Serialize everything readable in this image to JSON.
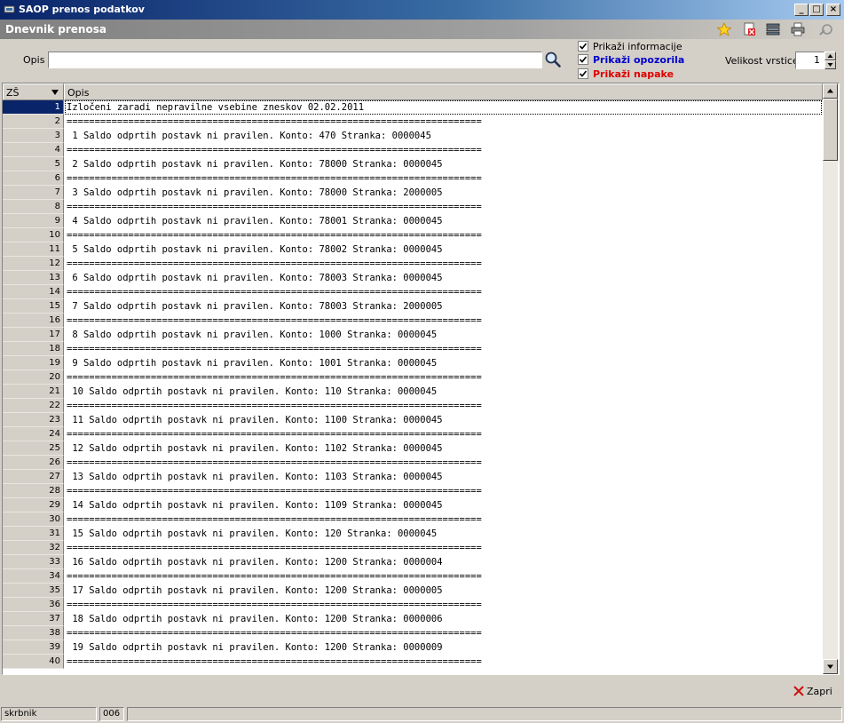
{
  "window": {
    "title": "SAOP prenos podatkov"
  },
  "panel": {
    "title": "Dnevnik prenosa"
  },
  "toolbar": {
    "icons": [
      "favorite-star-icon",
      "delete-doc-icon",
      "stack-icon",
      "print-icon",
      "tools-icon"
    ]
  },
  "filter": {
    "opis_label": "Opis",
    "opis_value": "",
    "show_info": {
      "label": "Prikaži informacije",
      "checked": true,
      "color": "#000000"
    },
    "show_warnings": {
      "label": "Prikaži opozorila",
      "checked": true,
      "color": "#0000cc"
    },
    "show_errors": {
      "label": "Prikaži napake",
      "checked": true,
      "color": "#dd0000"
    },
    "row_size_label": "Velikost vrstice",
    "row_size_value": "1"
  },
  "grid": {
    "columns": [
      "ZŠ",
      "Opis"
    ],
    "rows": [
      {
        "n": "1",
        "text": "Izločeni zaradi nepravilne vsebine zneskov 02.02.2011"
      },
      {
        "n": "2",
        "text": "=========================================================================="
      },
      {
        "n": "3",
        "text": " 1 Saldo odprtih postavk ni pravilen. Konto: 470 Stranka: 0000045"
      },
      {
        "n": "4",
        "text": "=========================================================================="
      },
      {
        "n": "5",
        "text": " 2 Saldo odprtih postavk ni pravilen. Konto: 78000 Stranka: 0000045"
      },
      {
        "n": "6",
        "text": "=========================================================================="
      },
      {
        "n": "7",
        "text": " 3 Saldo odprtih postavk ni pravilen. Konto: 78000 Stranka: 2000005"
      },
      {
        "n": "8",
        "text": "=========================================================================="
      },
      {
        "n": "9",
        "text": " 4 Saldo odprtih postavk ni pravilen. Konto: 78001 Stranka: 0000045"
      },
      {
        "n": "10",
        "text": "=========================================================================="
      },
      {
        "n": "11",
        "text": " 5 Saldo odprtih postavk ni pravilen. Konto: 78002 Stranka: 0000045"
      },
      {
        "n": "12",
        "text": "=========================================================================="
      },
      {
        "n": "13",
        "text": " 6 Saldo odprtih postavk ni pravilen. Konto: 78003 Stranka: 0000045"
      },
      {
        "n": "14",
        "text": "=========================================================================="
      },
      {
        "n": "15",
        "text": " 7 Saldo odprtih postavk ni pravilen. Konto: 78003 Stranka: 2000005"
      },
      {
        "n": "16",
        "text": "=========================================================================="
      },
      {
        "n": "17",
        "text": " 8 Saldo odprtih postavk ni pravilen. Konto: 1000 Stranka: 0000045"
      },
      {
        "n": "18",
        "text": "=========================================================================="
      },
      {
        "n": "19",
        "text": " 9 Saldo odprtih postavk ni pravilen. Konto: 1001 Stranka: 0000045"
      },
      {
        "n": "20",
        "text": "=========================================================================="
      },
      {
        "n": "21",
        "text": " 10 Saldo odprtih postavk ni pravilen. Konto: 110 Stranka: 0000045"
      },
      {
        "n": "22",
        "text": "=========================================================================="
      },
      {
        "n": "23",
        "text": " 11 Saldo odprtih postavk ni pravilen. Konto: 1100 Stranka: 0000045"
      },
      {
        "n": "24",
        "text": "=========================================================================="
      },
      {
        "n": "25",
        "text": " 12 Saldo odprtih postavk ni pravilen. Konto: 1102 Stranka: 0000045"
      },
      {
        "n": "26",
        "text": "=========================================================================="
      },
      {
        "n": "27",
        "text": " 13 Saldo odprtih postavk ni pravilen. Konto: 1103 Stranka: 0000045"
      },
      {
        "n": "28",
        "text": "=========================================================================="
      },
      {
        "n": "29",
        "text": " 14 Saldo odprtih postavk ni pravilen. Konto: 1109 Stranka: 0000045"
      },
      {
        "n": "30",
        "text": "=========================================================================="
      },
      {
        "n": "31",
        "text": " 15 Saldo odprtih postavk ni pravilen. Konto: 120 Stranka: 0000045"
      },
      {
        "n": "32",
        "text": "=========================================================================="
      },
      {
        "n": "33",
        "text": " 16 Saldo odprtih postavk ni pravilen. Konto: 1200 Stranka: 0000004"
      },
      {
        "n": "34",
        "text": "=========================================================================="
      },
      {
        "n": "35",
        "text": " 17 Saldo odprtih postavk ni pravilen. Konto: 1200 Stranka: 0000005"
      },
      {
        "n": "36",
        "text": "=========================================================================="
      },
      {
        "n": "37",
        "text": " 18 Saldo odprtih postavk ni pravilen. Konto: 1200 Stranka: 0000006"
      },
      {
        "n": "38",
        "text": "=========================================================================="
      },
      {
        "n": "39",
        "text": " 19 Saldo odprtih postavk ni pravilen. Konto: 1200 Stranka: 0000009"
      },
      {
        "n": "40",
        "text": "=========================================================================="
      }
    ]
  },
  "footer": {
    "close_label": "Zapri"
  },
  "status": {
    "user": "skrbnik",
    "code": "006"
  }
}
